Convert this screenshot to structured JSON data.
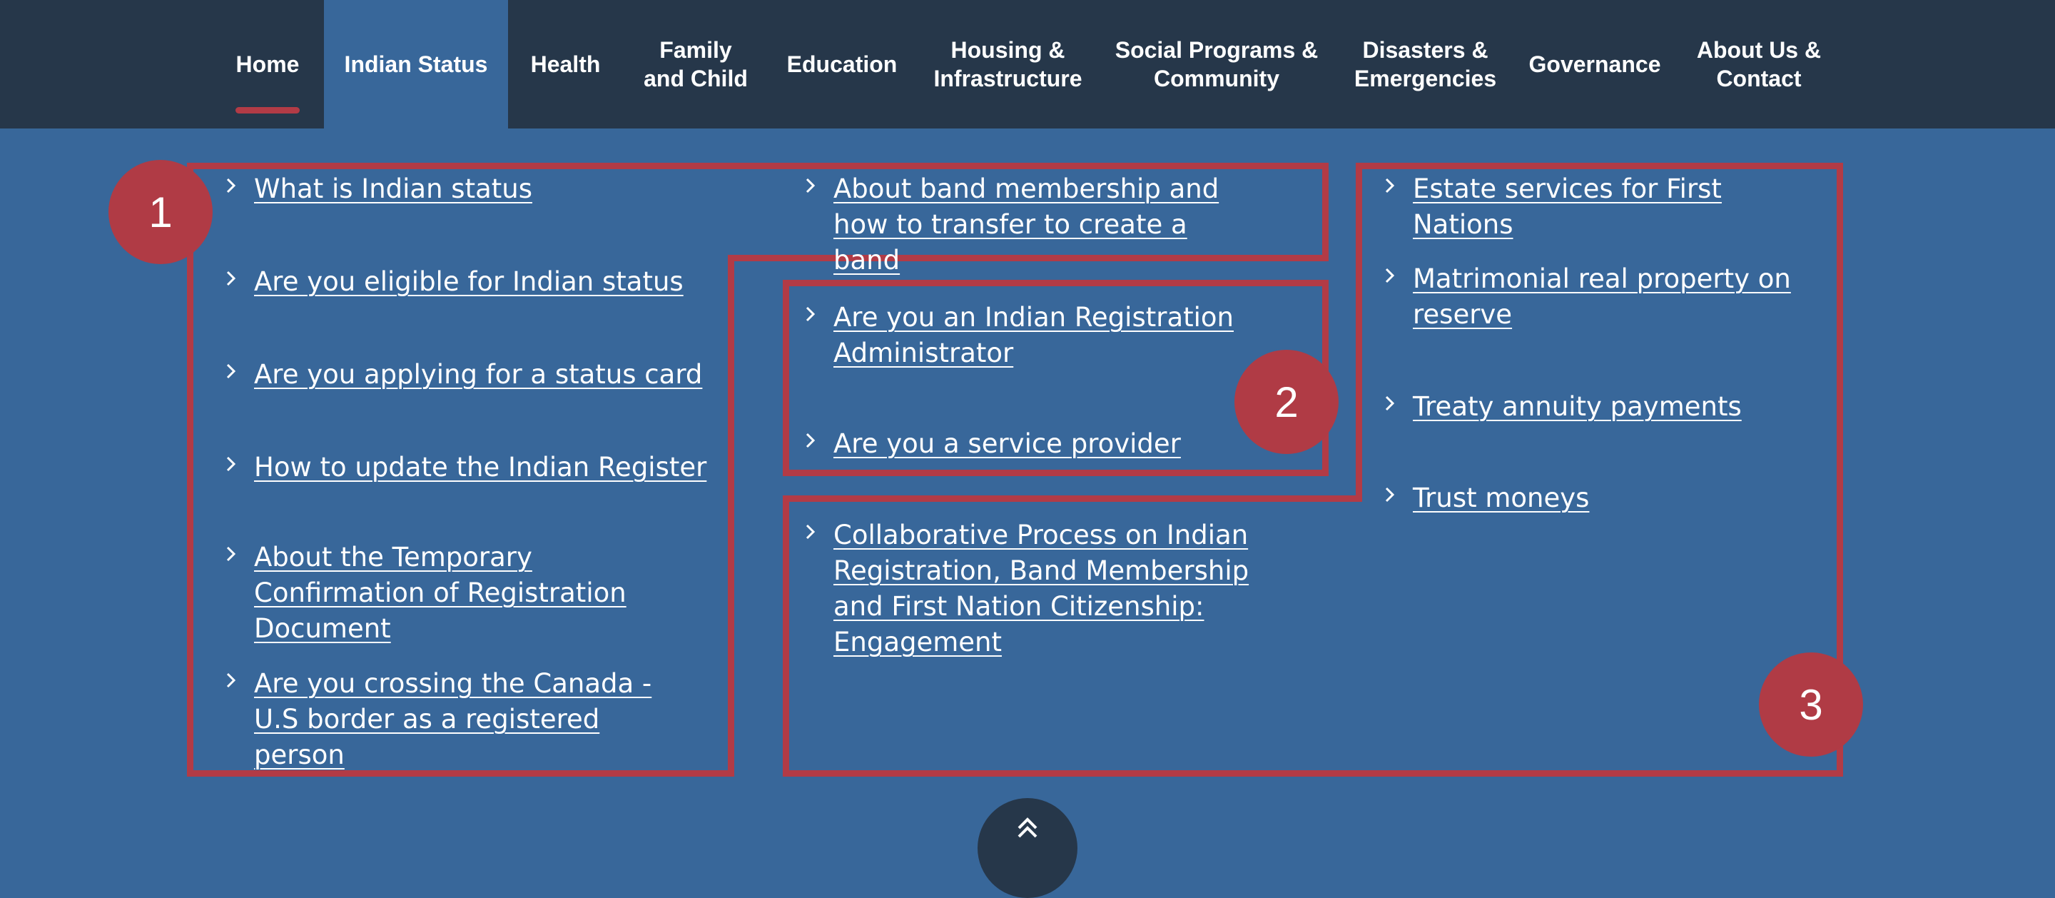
{
  "nav": {
    "items": [
      {
        "label": "Home"
      },
      {
        "label": "Indian Status"
      },
      {
        "label": "Health"
      },
      {
        "label": "Family\nand Child"
      },
      {
        "label": "Education"
      },
      {
        "label": "Housing &\nInfrastructure"
      },
      {
        "label": "Social Programs &\nCommunity"
      },
      {
        "label": "Disasters &\nEmergencies"
      },
      {
        "label": "Governance"
      },
      {
        "label": "About Us &\nContact"
      }
    ],
    "active": "Indian Status"
  },
  "menu": {
    "col1": [
      "What is Indian status",
      "Are you eligible for Indian status",
      "Are you applying for a status card",
      "How to update the Indian Register",
      "About the Temporary Confirmation of Registration Document",
      "Are you crossing the Canada - U.S border as a registered person"
    ],
    "col2": [
      "About band membership and how to transfer to create a band",
      "Are you an Indian Registration Administrator",
      "Are you a service provider",
      "Collaborative Process on Indian Registration, Band Membership and First Nation Citizenship: Engagement"
    ],
    "col3": [
      "Estate services for First Nations",
      "Matrimonial real property on reserve",
      "Treaty annuity payments",
      "Trust moneys"
    ]
  },
  "badges": [
    "1",
    "2",
    "3"
  ],
  "colors": {
    "nav_bg": "#26374a",
    "menu_bg": "#38679a",
    "highlight_red": "#b23b46",
    "text": "#ffffff"
  },
  "icons": {
    "link_marker": "chevron-right-icon",
    "back_to_top": "double-chevron-up-icon"
  }
}
